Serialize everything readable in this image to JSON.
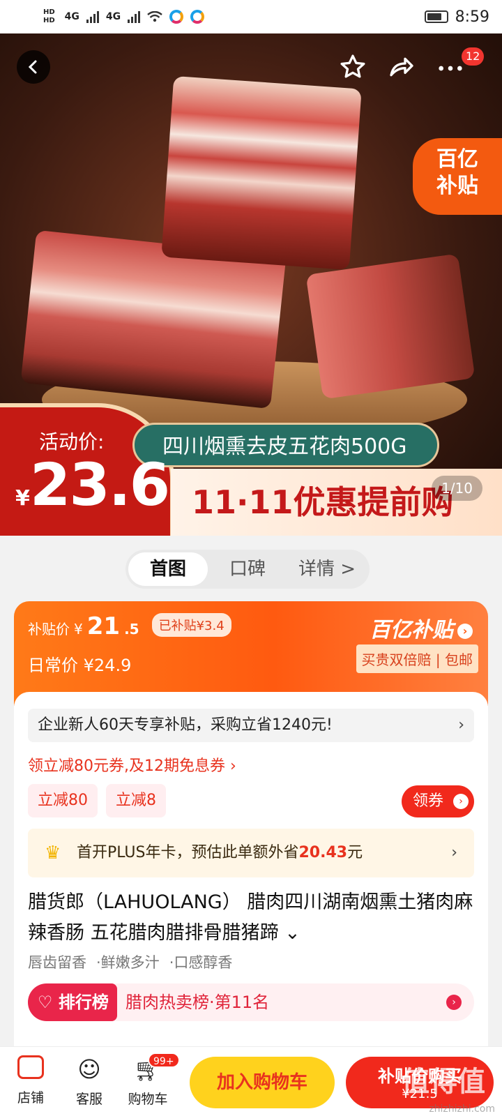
{
  "status_bar": {
    "hd1": "HD",
    "hd2": "HD",
    "net1": "4G",
    "net2": "4G",
    "time": "8:59"
  },
  "hero": {
    "more_badge": "12",
    "yi_corner_line1": "百亿",
    "yi_corner_line2": "补贴",
    "activity_label": "活动价:",
    "activity_currency": "¥",
    "activity_price": "23.6",
    "product_banner": "四川烟熏去皮五花肉500G",
    "promo_text": "11·11优惠提前购",
    "page_indicator": "1/10",
    "icons": {
      "back": "back-arrow-icon",
      "favorite": "star-icon",
      "share": "share-icon",
      "more": "more-icon"
    }
  },
  "tabs": [
    {
      "label": "首图",
      "active": true
    },
    {
      "label": "口碑",
      "active": false
    },
    {
      "label": "详情 >",
      "active": false
    }
  ],
  "subsidy": {
    "subsidy_price_label": "补贴价",
    "currency": "¥",
    "price_int": "21",
    "price_dec": ".5",
    "subsidized_tag": "已补贴¥3.4",
    "regular_label": "日常价",
    "regular_price": "¥24.9",
    "brand": "百亿补贴",
    "guarantee": "买贵双倍赔 | 包邮"
  },
  "offers": {
    "newbie_text": "企业新人60天专享补贴，采购立省1240元!",
    "coupon_line": "领立减80元券,及12期免息券 ›",
    "chips": [
      "立减80",
      "立减8"
    ],
    "get_coupon": "领券",
    "plus_prefix": "首开PLUS年卡，预估此单额外省",
    "plus_amount": "20.43",
    "plus_suffix": "元"
  },
  "product": {
    "title": "腊货郎（LAHUOLANG） 腊肉四川湖南烟熏土猪肉麻辣香肠 五花腊肉腊排骨腊猪蹄 ⌄",
    "tags": [
      "唇齿留香",
      "·鲜嫩多汁",
      "·口感醇香"
    ],
    "rank_badge": "排行榜",
    "rank_text": "腊肉热卖榜·第11名"
  },
  "bottom_bar": {
    "shop": "店铺",
    "service": "客服",
    "cart": "购物车",
    "cart_badge": "99+",
    "add_to_cart": "加入购物车",
    "buy_now": "补贴价购买",
    "buy_price": "¥21.5"
  },
  "watermark": {
    "main": "值得值",
    "sub": "zhizhizhi.com"
  },
  "colors": {
    "accent_red": "#f1291c",
    "accent_orange": "#ff6a12",
    "accent_yellow": "#ffd21d"
  }
}
